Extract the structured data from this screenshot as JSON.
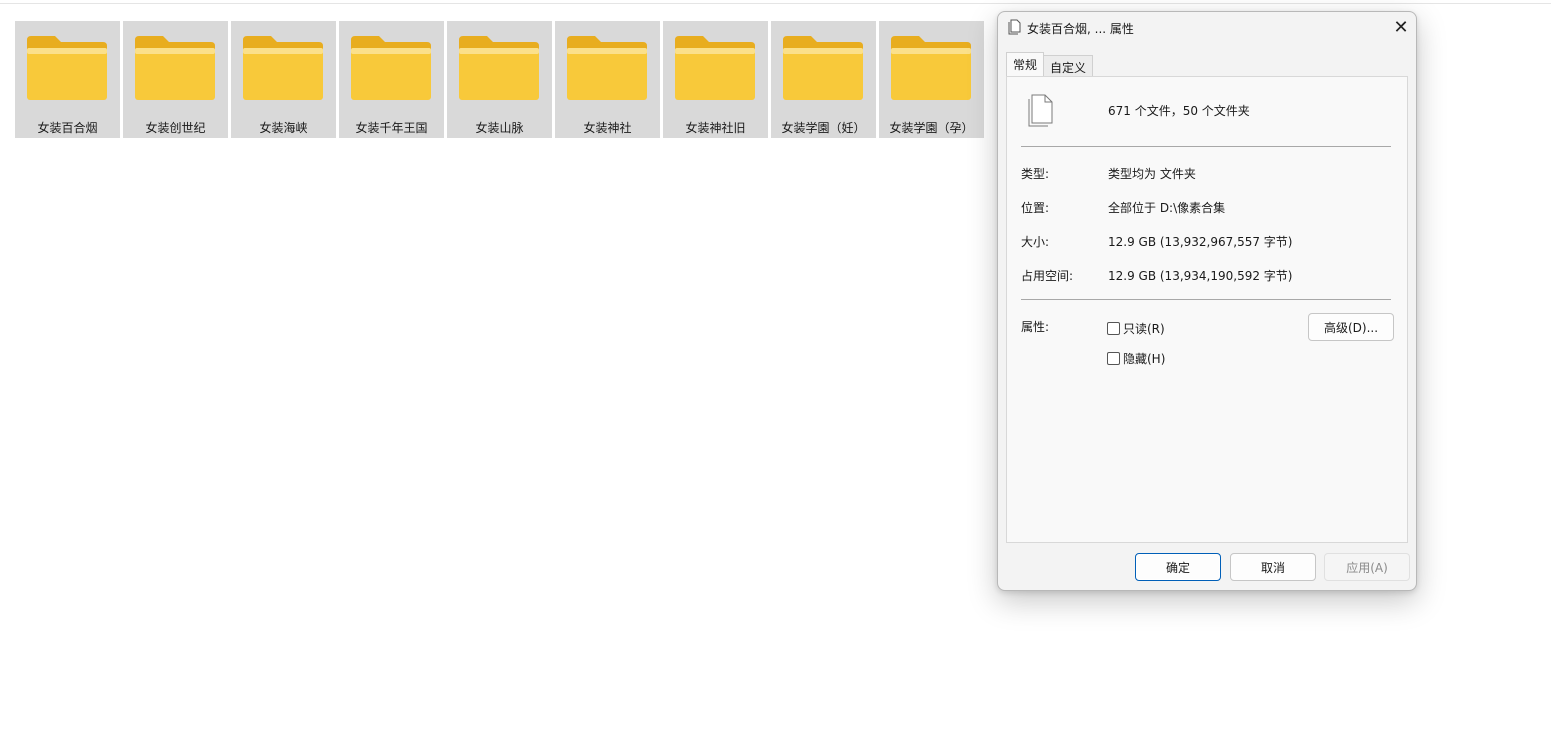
{
  "folders": [
    {
      "name": "女装百合烟"
    },
    {
      "name": "女装创世纪"
    },
    {
      "name": "女装海峡"
    },
    {
      "name": "女装千年王国"
    },
    {
      "name": "女装山脉"
    },
    {
      "name": "女装神社"
    },
    {
      "name": "女装神社旧"
    },
    {
      "name": "女装学園（妊）"
    },
    {
      "name": "女装学園（孕）"
    }
  ],
  "dialog": {
    "title": "女装百合烟, ... 属性",
    "close_glyph": "✕",
    "tabs": [
      "常规",
      "自定义"
    ],
    "summary": "671 个文件，50 个文件夹",
    "type_label": "类型:",
    "type_value": "类型均为 文件夹",
    "location_label": "位置:",
    "location_value": "全部位于 D:\\像素合集",
    "size_label": "大小:",
    "size_value": "12.9 GB (13,932,967,557 字节)",
    "disk_label": "占用空间:",
    "disk_value": "12.9 GB (13,934,190,592 字节)",
    "attributes_label": "属性:",
    "readonly_label": "只读(R)",
    "hidden_label": "隐藏(H)",
    "advanced_button": "高级(D)...",
    "ok_button": "确定",
    "cancel_button": "取消",
    "apply_button": "应用(A)"
  },
  "colors": {
    "folder_tile_bg": "#d9d9d9",
    "folder_yellow": "#f8c93a",
    "accent": "#005fb8"
  }
}
